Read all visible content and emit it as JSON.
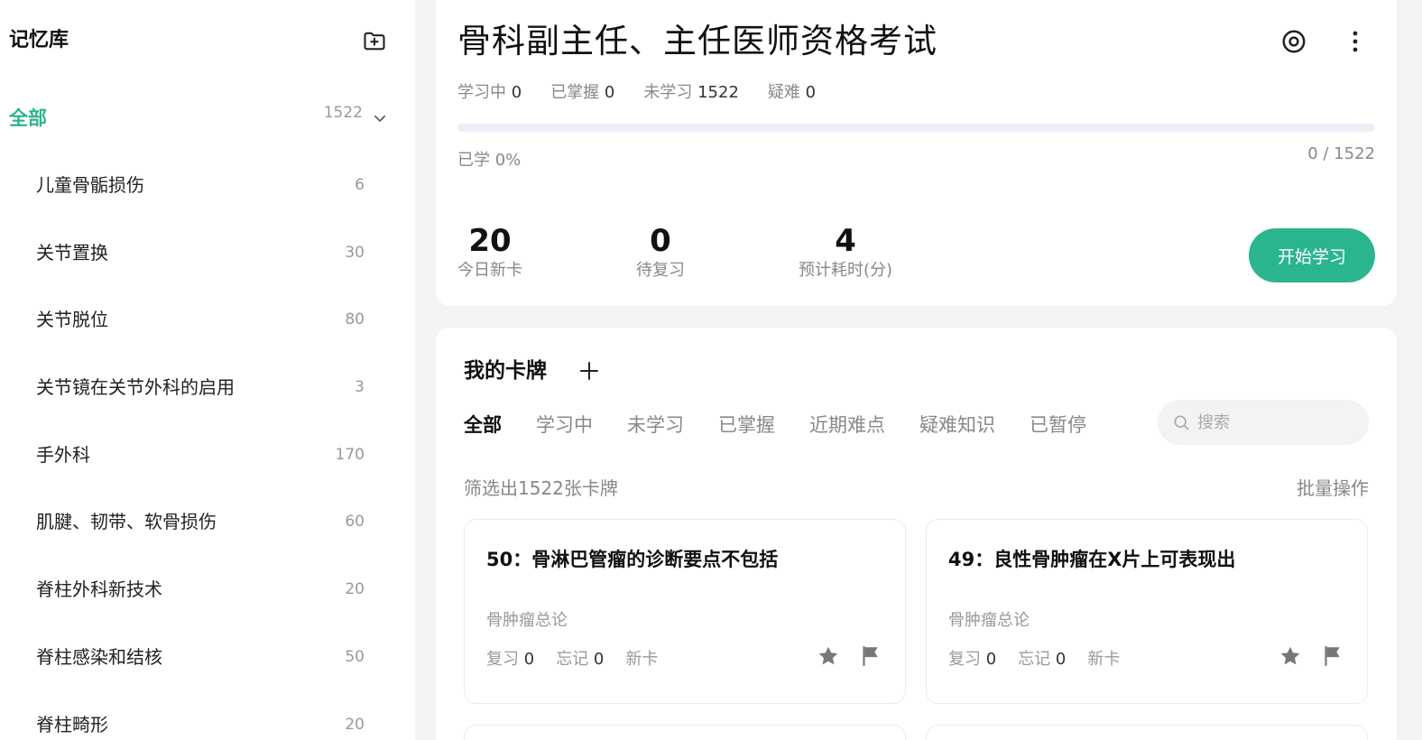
{
  "sidebar": {
    "title": "记忆库",
    "all": {
      "label": "全部",
      "count": "1522"
    },
    "items": [
      {
        "label": "儿童骨骺损伤",
        "count": "6"
      },
      {
        "label": "关节置换",
        "count": "30"
      },
      {
        "label": "关节脱位",
        "count": "80"
      },
      {
        "label": "关节镜在关节外科的启用",
        "count": "3"
      },
      {
        "label": "手外科",
        "count": "170"
      },
      {
        "label": "肌腱、韧带、软骨损伤",
        "count": "60"
      },
      {
        "label": "脊柱外科新技术",
        "count": "20"
      },
      {
        "label": "脊柱感染和结核",
        "count": "50"
      },
      {
        "label": "脊柱畸形",
        "count": "20"
      }
    ]
  },
  "deck": {
    "title": "骨科副主任、主任医师资格考试",
    "stats": {
      "learning_label": "学习中",
      "learning": "0",
      "mastered_label": "已掌握",
      "mastered": "0",
      "unlearned_label": "未学习",
      "unlearned": "1522",
      "difficult_label": "疑难",
      "difficult": "0"
    },
    "progress_percent": 0,
    "learned_text": "已学 0%",
    "learned_count": "0 / 1522",
    "metrics": {
      "new_today": "20",
      "new_today_label": "今日新卡",
      "to_review": "0",
      "to_review_label": "待复习",
      "est_time": "4",
      "est_time_label": "预计耗时(分)"
    },
    "start_button": "开始学习"
  },
  "cards_panel": {
    "title": "我的卡牌",
    "tabs": [
      "全部",
      "学习中",
      "未学习",
      "已掌握",
      "近期难点",
      "疑难知识",
      "已暂停"
    ],
    "search_placeholder": "搜索",
    "filter_text": "筛选出1522张卡牌",
    "batch_label": "批量操作",
    "cards": [
      {
        "question": "50：骨淋巴管瘤的诊断要点不包括",
        "category": "骨肿瘤总论",
        "review_label": "复习",
        "review": "0",
        "forget_label": "忘记",
        "forget": "0",
        "status": "新卡"
      },
      {
        "question": "49：良性骨肿瘤在X片上可表现出",
        "category": "骨肿瘤总论",
        "review_label": "复习",
        "review": "0",
        "forget_label": "忘记",
        "forget": "0",
        "status": "新卡"
      }
    ]
  },
  "colors": {
    "accent": "#2bb58f",
    "background": "#f4f4f5",
    "icon": "#777777"
  },
  "icons": {
    "new_folder": "folder-plus-icon",
    "chevron": "chevron-down-icon",
    "settings": "settings-ring-icon",
    "more": "more-vertical-icon",
    "add": "plus-icon",
    "search": "search-icon",
    "star": "star-icon",
    "flag": "flag-icon"
  }
}
